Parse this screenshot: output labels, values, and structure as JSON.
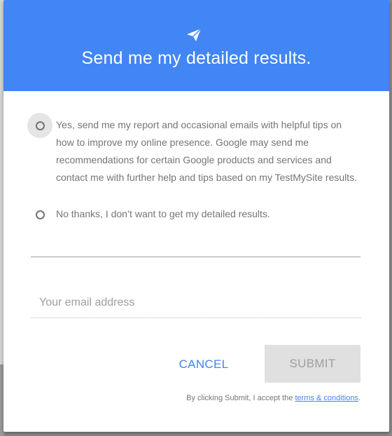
{
  "dialog": {
    "header": {
      "icon": "send-icon",
      "title": "Send me my detailed results."
    },
    "options": [
      {
        "label": "Yes, send me my report and occasional emails with helpful tips on how to improve my online presence. Google may send me recommendations for certain Google products and services and contact me with further help and tips based on my TestMySite results.",
        "selected": false,
        "focused": true
      },
      {
        "label": "No thanks, I don’t want to get my detailed results.",
        "selected": false,
        "focused": false
      }
    ],
    "email": {
      "placeholder": "Your email address",
      "value": ""
    },
    "actions": {
      "cancel_label": "CANCEL",
      "submit_label": "SUBMIT"
    },
    "legal": {
      "prefix": "By clicking Submit, I accept the ",
      "link_text": "terms & conditions",
      "suffix": "."
    }
  },
  "colors": {
    "header_bg": "#4285f4",
    "accent": "#4285f4",
    "submit_disabled_bg": "#e0e0e0"
  }
}
